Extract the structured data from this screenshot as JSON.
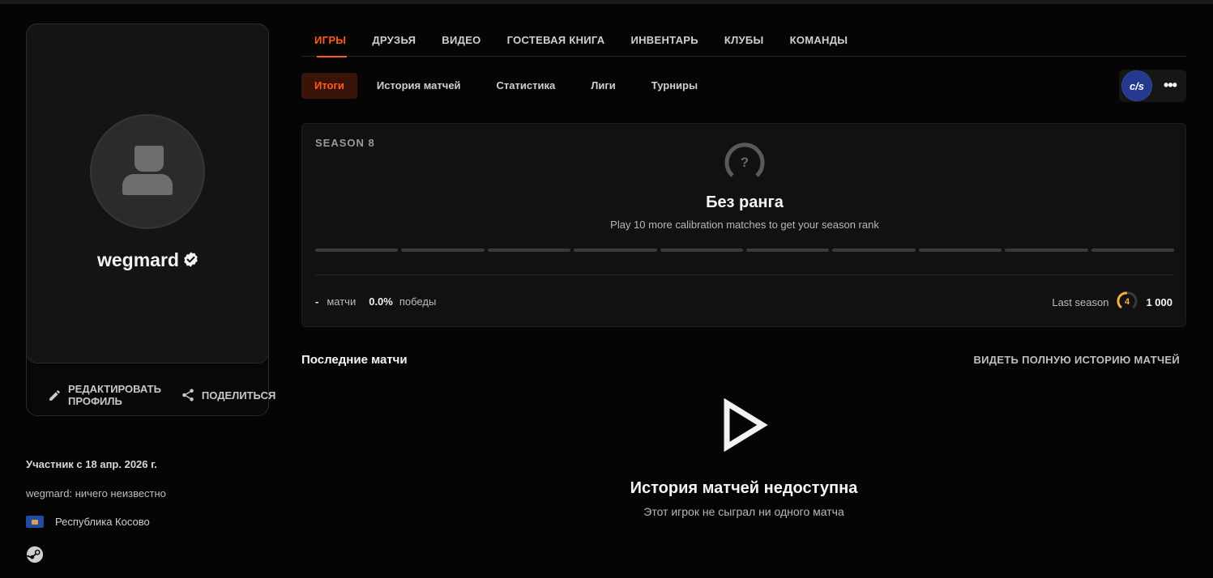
{
  "profile": {
    "username": "wegmard",
    "edit_label": "РЕДАКТИРОВАТЬ ПРОФИЛЬ",
    "share_label": "ПОДЕЛИТЬСЯ",
    "member_since": "Участник с 18 апр. 2026 г.",
    "bio": "wegmard: ничего неизвестно",
    "country": "Республика Косово",
    "icons": [
      "avatar-placeholder-icon",
      "verified-badge-icon",
      "pencil-icon",
      "share-icon",
      "kosovo-flag-icon",
      "steam-icon"
    ]
  },
  "main_tabs": [
    "ИГРЫ",
    "ДРУЗЬЯ",
    "ВИДЕО",
    "ГОСТЕВАЯ КНИГА",
    "ИНВЕНТАРЬ",
    "КЛУБЫ",
    "КОМАНДЫ"
  ],
  "sub_tabs": [
    "Итоги",
    "История матчей",
    "Статистика",
    "Лиги",
    "Турниры"
  ],
  "game_switch": {
    "logo_text": "c/s",
    "more": "•••"
  },
  "season": {
    "label": "SEASON 8",
    "rank_symbol": "?",
    "rank_title": "Без ранга",
    "rank_subtitle": "Play 10 more calibration matches to get your season rank",
    "calibration_segments": 10,
    "matches_value": "-",
    "matches_label": "матчи",
    "winrate_value": "0.0%",
    "winrate_label": "победы",
    "last_season_label": "Last season",
    "last_season_level": "4",
    "last_season_points": "1 000"
  },
  "recent": {
    "title": "Последние матчи",
    "full_history": "ВИДЕТЬ ПОЛНУЮ ИСТОРИЮ МАТЧЕЙ",
    "empty_title": "История матчей недоступна",
    "empty_subtitle": "Этот игрок не сыграл ни одного матча"
  },
  "colors": {
    "accent": "#ff5a1f",
    "active_sub_bg": "#3a1408",
    "level_ring": "#f2b33d",
    "cs_logo_bg": "#253a8f"
  }
}
